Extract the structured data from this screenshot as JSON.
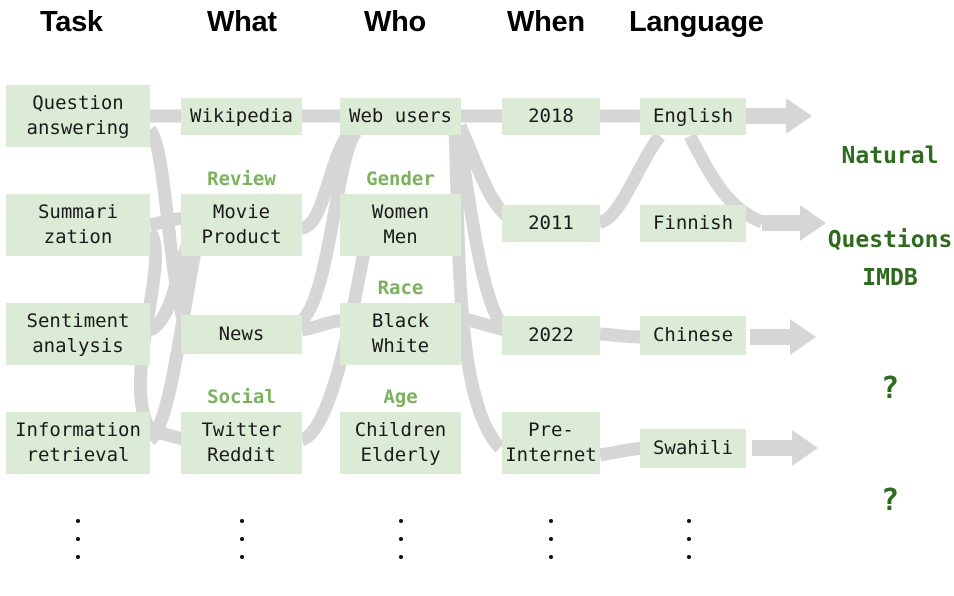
{
  "figure": {
    "title_headers": [
      "Task",
      "What",
      "Who",
      "When",
      "Language"
    ],
    "ellipsis_glyph": "vertical-ellipsis"
  },
  "columns": {
    "task": {
      "header": "Task"
    },
    "what": {
      "header": "What"
    },
    "who": {
      "header": "Who"
    },
    "when": {
      "header": "When"
    },
    "language": {
      "header": "Language"
    }
  },
  "rows": [
    {
      "task": {
        "lines": [
          "Question",
          "answering"
        ]
      },
      "what": {
        "category": "",
        "lines": [
          "Wikipedia"
        ]
      },
      "who": {
        "category": "",
        "lines": [
          "Web users"
        ]
      },
      "when": {
        "lines": [
          "2018"
        ]
      },
      "language": {
        "lines": [
          "English"
        ]
      },
      "output": {
        "lines": [
          "Natural",
          "Questions"
        ],
        "is_question": false
      }
    },
    {
      "task": {
        "lines": [
          "Summari",
          "zation"
        ]
      },
      "what": {
        "category": "Review",
        "lines": [
          "Movie",
          "Product"
        ]
      },
      "who": {
        "category": "Gender",
        "lines": [
          "Women",
          "Men"
        ]
      },
      "when": {
        "lines": [
          "2011"
        ]
      },
      "language": {
        "lines": [
          "Finnish"
        ]
      },
      "output": {
        "lines": [
          "IMDB"
        ],
        "is_question": false
      }
    },
    {
      "task": {
        "lines": [
          "Sentiment",
          "analysis"
        ]
      },
      "what": {
        "category": "",
        "lines": [
          "News"
        ]
      },
      "who": {
        "category": "Race",
        "lines": [
          "Black",
          "White"
        ]
      },
      "when": {
        "lines": [
          "2022"
        ]
      },
      "language": {
        "lines": [
          "Chinese"
        ]
      },
      "output": {
        "lines": [
          "?"
        ],
        "is_question": true
      }
    },
    {
      "task": {
        "lines": [
          "Information",
          "retrieval"
        ]
      },
      "what": {
        "category": "Social",
        "lines": [
          "Twitter",
          "Reddit"
        ]
      },
      "who": {
        "category": "Age",
        "lines": [
          "Children",
          "Elderly"
        ]
      },
      "when": {
        "lines": [
          "Pre-",
          "Internet"
        ]
      },
      "language": {
        "lines": [
          "Swahili"
        ]
      },
      "output": {
        "lines": [
          "?"
        ],
        "is_question": true
      }
    }
  ],
  "colors": {
    "box_fill": "#dcebd5",
    "category_label": "#7cb25f",
    "output_text": "#2e6b1e",
    "flow_ribbon": "#d6d6d6",
    "header_text": "#000000",
    "box_text": "#1a1a1a",
    "background": "#ffffff"
  },
  "footnote": {
    "text": ""
  }
}
